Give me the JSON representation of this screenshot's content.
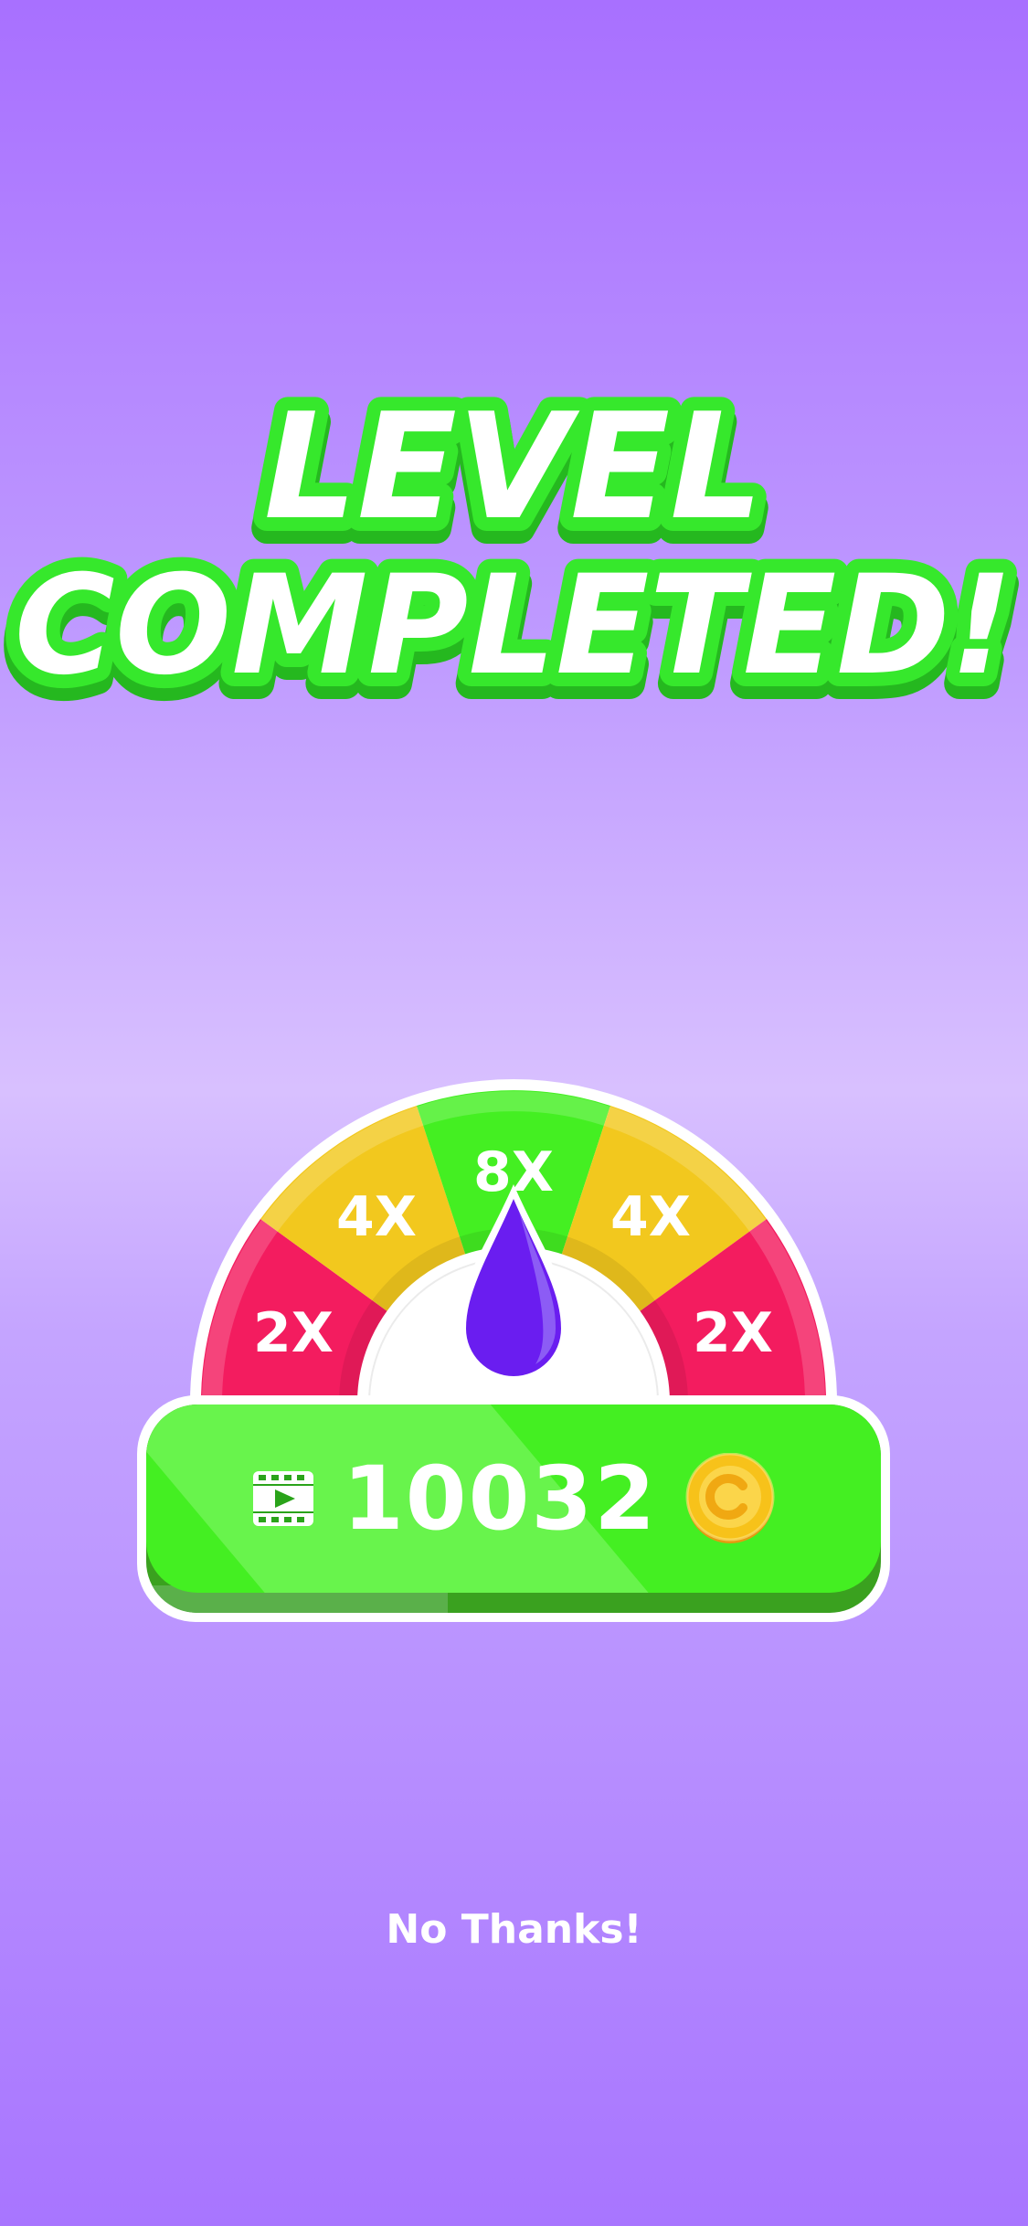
{
  "title": {
    "line1": "LEVEL",
    "line2": "COMPLETED!"
  },
  "multiplier": {
    "segments": [
      "2X",
      "4X",
      "8X",
      "4X",
      "2X"
    ],
    "colors": {
      "red": "#f31c5f",
      "yellow": "#f2c81e",
      "green": "#44ef22"
    },
    "selected": "8X"
  },
  "reward": {
    "amount": "10032",
    "icon": "video-ad-icon",
    "currency_icon": "coin-icon"
  },
  "secondary_action": {
    "label": "No Thanks!"
  },
  "colors": {
    "title_text": "#ffffff",
    "title_outline": "#2fe02a",
    "button_green": "#44ef22",
    "needle_purple": "#6a1df0",
    "coin_gold": "#f7c21a"
  }
}
